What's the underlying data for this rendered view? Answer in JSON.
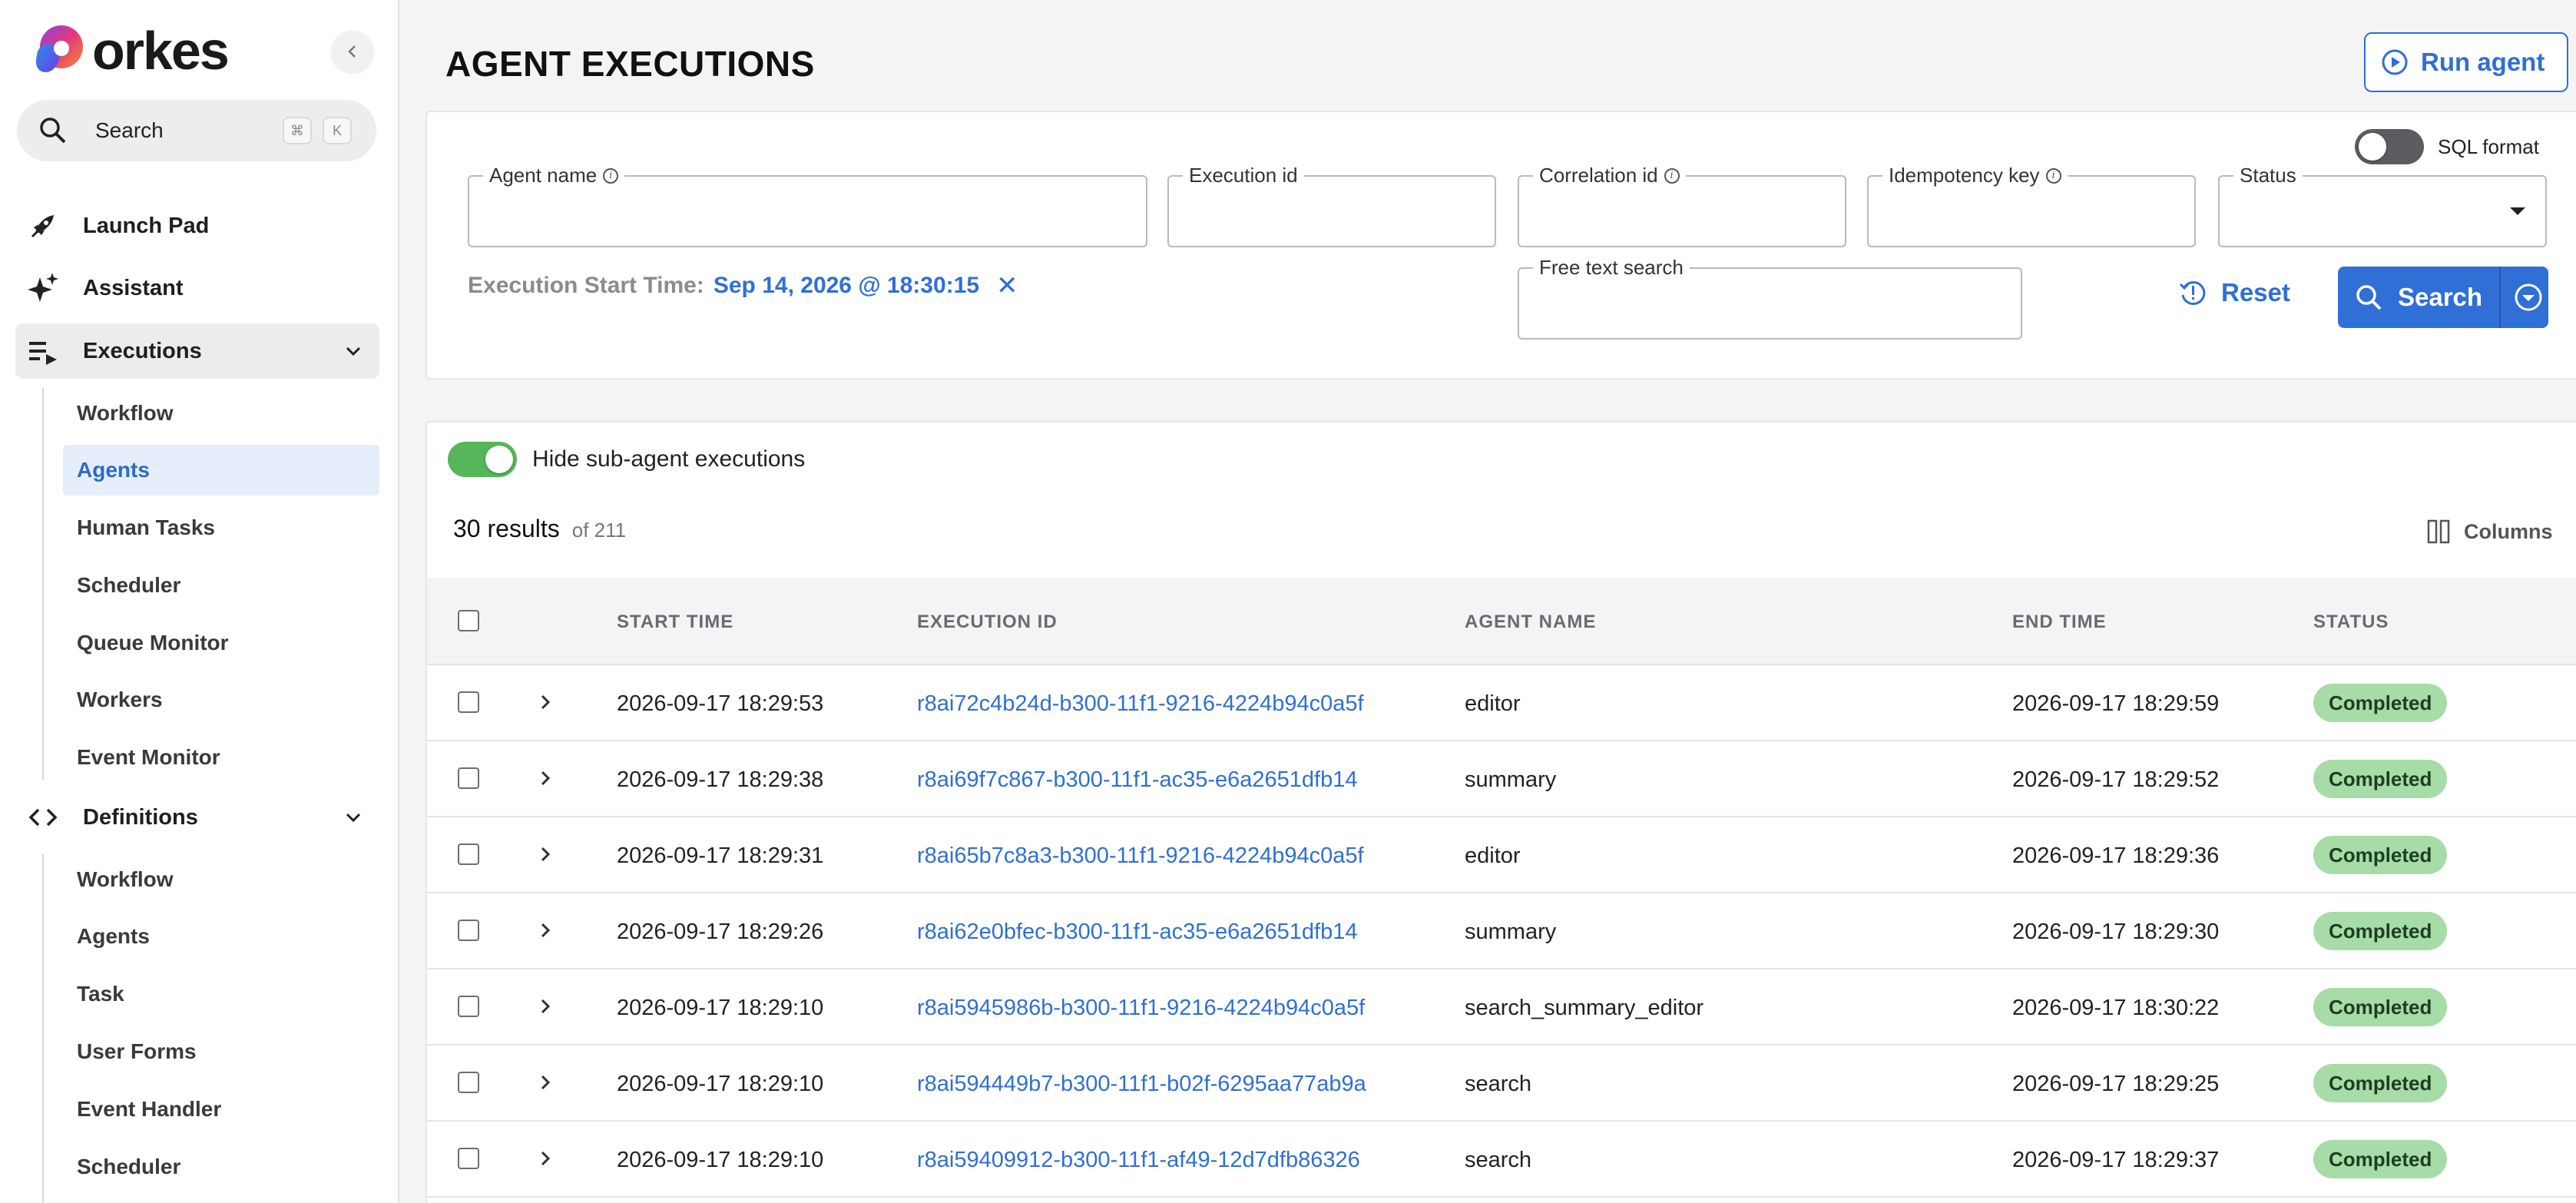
{
  "app": {
    "logo_text": "orkes"
  },
  "sidebar": {
    "search_label": "Search",
    "kbd_cmd": "⌘",
    "kbd_k": "K",
    "items": [
      {
        "label": "Launch Pad",
        "icon": "rocket-icon"
      },
      {
        "label": "Assistant",
        "icon": "sparkle-icon"
      },
      {
        "label": "Executions",
        "icon": "list-play-icon"
      },
      {
        "label": "Definitions",
        "icon": "code-icon"
      }
    ],
    "executions_sub": [
      "Workflow",
      "Agents",
      "Human Tasks",
      "Scheduler",
      "Queue Monitor",
      "Workers",
      "Event Monitor"
    ],
    "definitions_sub": [
      "Workflow",
      "Agents",
      "Task",
      "User Forms",
      "Event Handler",
      "Scheduler"
    ],
    "active_sub": "Agents"
  },
  "header": {
    "title": "AGENT EXECUTIONS",
    "run_agent_label": "Run agent"
  },
  "filters": {
    "sql_format_label": "SQL format",
    "sql_format_on": false,
    "agent_name_label": "Agent name",
    "execution_id_label": "Execution id",
    "correlation_id_label": "Correlation id",
    "idempotency_key_label": "Idempotency key",
    "status_label": "Status",
    "free_text_label": "Free text search",
    "exec_start_label": "Execution Start Time:",
    "exec_start_value": "Sep 14, 2026 @ 18:30:15",
    "reset_label": "Reset",
    "search_label": "Search"
  },
  "results": {
    "hide_sub_label": "Hide sub-agent executions",
    "hide_sub_on": true,
    "count_text": "30 results",
    "of_text": "of 211",
    "columns_label": "Columns",
    "headers": {
      "start_time": "START TIME",
      "execution_id": "EXECUTION ID",
      "agent_name": "AGENT NAME",
      "end_time": "END TIME",
      "status": "STATUS"
    },
    "rows": [
      {
        "start": "2026-09-17 18:29:53",
        "id": "r8ai72c4b24d-b300-11f1-9216-4224b94c0a5f",
        "agent": "editor",
        "end": "2026-09-17 18:29:59",
        "status": "Completed"
      },
      {
        "start": "2026-09-17 18:29:38",
        "id": "r8ai69f7c867-b300-11f1-ac35-e6a2651dfb14",
        "agent": "summary",
        "end": "2026-09-17 18:29:52",
        "status": "Completed"
      },
      {
        "start": "2026-09-17 18:29:31",
        "id": "r8ai65b7c8a3-b300-11f1-9216-4224b94c0a5f",
        "agent": "editor",
        "end": "2026-09-17 18:29:36",
        "status": "Completed"
      },
      {
        "start": "2026-09-17 18:29:26",
        "id": "r8ai62e0bfec-b300-11f1-ac35-e6a2651dfb14",
        "agent": "summary",
        "end": "2026-09-17 18:29:30",
        "status": "Completed"
      },
      {
        "start": "2026-09-17 18:29:10",
        "id": "r8ai5945986b-b300-11f1-9216-4224b94c0a5f",
        "agent": "search_summary_editor",
        "end": "2026-09-17 18:30:22",
        "status": "Completed"
      },
      {
        "start": "2026-09-17 18:29:10",
        "id": "r8ai594449b7-b300-11f1-b02f-6295aa77ab9a",
        "agent": "search",
        "end": "2026-09-17 18:29:25",
        "status": "Completed"
      },
      {
        "start": "2026-09-17 18:29:10",
        "id": "r8ai59409912-b300-11f1-af49-12d7dfb86326",
        "agent": "search",
        "end": "2026-09-17 18:29:37",
        "status": "Completed"
      }
    ]
  },
  "colors": {
    "accent": "#2f6fd6",
    "status_completed_bg": "#a7dba8",
    "toggle_on": "#55b65a"
  }
}
